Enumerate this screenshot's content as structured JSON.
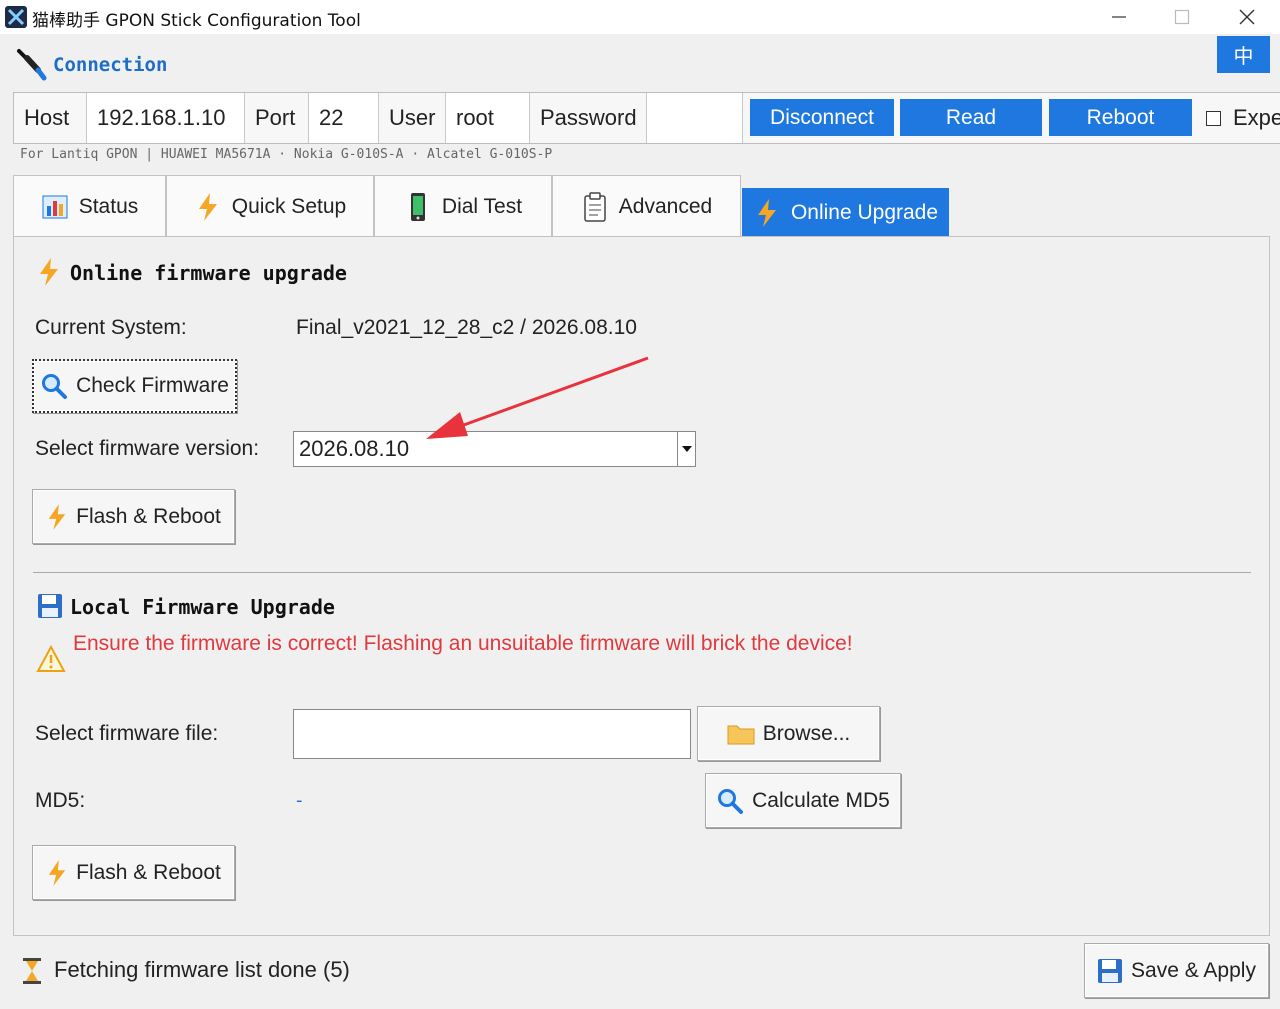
{
  "window": {
    "title": "猫棒助手  GPON Stick Configuration Tool",
    "icons": {
      "minimize": "minimize-icon",
      "maximize": "maximize-icon",
      "close": "close-icon"
    }
  },
  "header": {
    "title": "Connection",
    "lang_button": "中"
  },
  "connection": {
    "host_label": "Host",
    "host_value": "192.168.1.10",
    "port_label": "Port",
    "port_value": "22",
    "user_label": "User",
    "user_value": "root",
    "password_label": "Password",
    "password_value": "",
    "disconnect": "Disconnect",
    "read": "Read",
    "reboot": "Reboot",
    "expert_label": "Expe",
    "expert_checked": false
  },
  "support_line": "For Lantiq GPON | HUAWEI MA5671A · Nokia G-010S-A · Alcatel G-010S-P",
  "tabs": [
    {
      "label": "Status",
      "icon": "bar-chart-icon",
      "active": false
    },
    {
      "label": "Quick Setup",
      "icon": "lightning-icon",
      "active": false
    },
    {
      "label": "Dial Test",
      "icon": "phone-icon",
      "active": false
    },
    {
      "label": "Advanced",
      "icon": "clipboard-icon",
      "active": false
    },
    {
      "label": "Online Upgrade",
      "icon": "lightning-icon",
      "active": true
    }
  ],
  "online": {
    "title": "Online firmware upgrade",
    "current_label": "Current System:",
    "current_value": "Final_v2021_12_28_c2 / 2026.08.10",
    "check_button": "Check Firmware",
    "select_label": "Select firmware version:",
    "select_value": "2026.08.10",
    "flash_button": "Flash & Reboot"
  },
  "local": {
    "title": "Local Firmware Upgrade",
    "warning": "Ensure the firmware is correct! Flashing an unsuitable firmware will brick the device!",
    "file_label": "Select firmware file:",
    "file_value": "",
    "browse_button": "Browse...",
    "md5_label": "MD5:",
    "md5_value": "-",
    "md5_button": "Calculate MD5",
    "flash_button": "Flash & Reboot"
  },
  "status": {
    "text": "Fetching firmware list done (5)",
    "save_button": "Save & Apply"
  },
  "colors": {
    "accent": "#1e78e0",
    "warning": "#e0393e",
    "lightning": "#f5a623",
    "annotation_arrow": "#e8323c"
  }
}
